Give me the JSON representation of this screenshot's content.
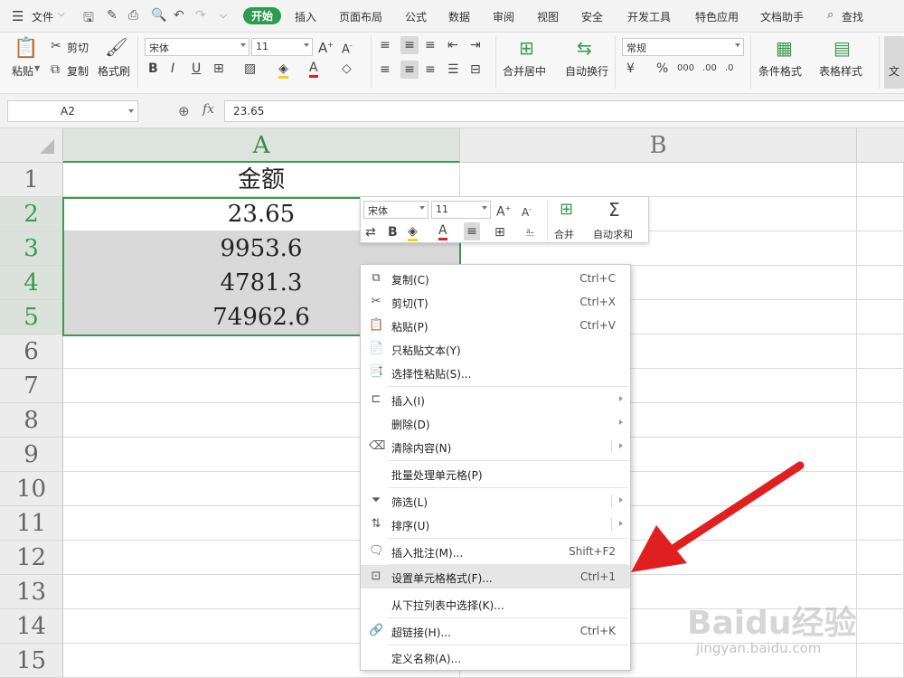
{
  "menubar": {
    "file_label": "文件",
    "tabs": [
      {
        "label": "开始",
        "active": true
      },
      {
        "label": "插入"
      },
      {
        "label": "页面布局"
      },
      {
        "label": "公式"
      },
      {
        "label": "数据"
      },
      {
        "label": "审阅"
      },
      {
        "label": "视图"
      },
      {
        "label": "安全"
      },
      {
        "label": "开发工具"
      },
      {
        "label": "特色应用"
      },
      {
        "label": "文档助手"
      }
    ],
    "search_label": "查找"
  },
  "ribbon": {
    "paste": "粘贴",
    "cut": "剪切",
    "copy": "复制",
    "format_painter": "格式刷",
    "font_name": "宋体",
    "font_size": "11",
    "merge_center": "合并居中",
    "auto_wrap": "自动换行",
    "number_format": "常规",
    "cond_format": "条件格式",
    "table_style": "表格样式",
    "doc_partial": "文"
  },
  "formula_bar": {
    "name_box": "A2",
    "fx": "fx",
    "value": "23.65"
  },
  "sheet": {
    "columns": [
      "A",
      "B"
    ],
    "rows": [
      "1",
      "2",
      "3",
      "4",
      "5",
      "6",
      "7",
      "8",
      "9",
      "10",
      "11",
      "12",
      "13",
      "14",
      "15"
    ],
    "cells": {
      "A1": "金额",
      "A2": "23.65",
      "A3": "9953.6",
      "A4": "4781.3",
      "A5": "74962.6"
    }
  },
  "mini_toolbar": {
    "font_name": "宋体",
    "font_size": "11",
    "merge": "合并",
    "auto_sum": "自动求和"
  },
  "context_menu": {
    "items": [
      {
        "label": "复制(C)",
        "shortcut": "Ctrl+C"
      },
      {
        "label": "剪切(T)",
        "shortcut": "Ctrl+X"
      },
      {
        "label": "粘贴(P)",
        "shortcut": "Ctrl+V"
      },
      {
        "label": "只粘贴文本(Y)"
      },
      {
        "label": "选择性粘贴(S)..."
      },
      {
        "label": "插入(I)"
      },
      {
        "label": "删除(D)"
      },
      {
        "label": "清除内容(N)"
      },
      {
        "label": "批量处理单元格(P)"
      },
      {
        "label": "筛选(L)"
      },
      {
        "label": "排序(U)"
      },
      {
        "label": "插入批注(M)...",
        "shortcut": "Shift+F2"
      },
      {
        "label": "设置单元格格式(F)...",
        "shortcut": "Ctrl+1"
      },
      {
        "label": "从下拉列表中选择(K)..."
      },
      {
        "label": "超链接(H)...",
        "shortcut": "Ctrl+K"
      },
      {
        "label": "定义名称(A)..."
      }
    ]
  },
  "colors": {
    "accent_green": "#2e9b4f",
    "arrow_red": "#e02020"
  },
  "watermark": {
    "brand": "Baidu经验",
    "url": "jingyan.baidu.com"
  }
}
